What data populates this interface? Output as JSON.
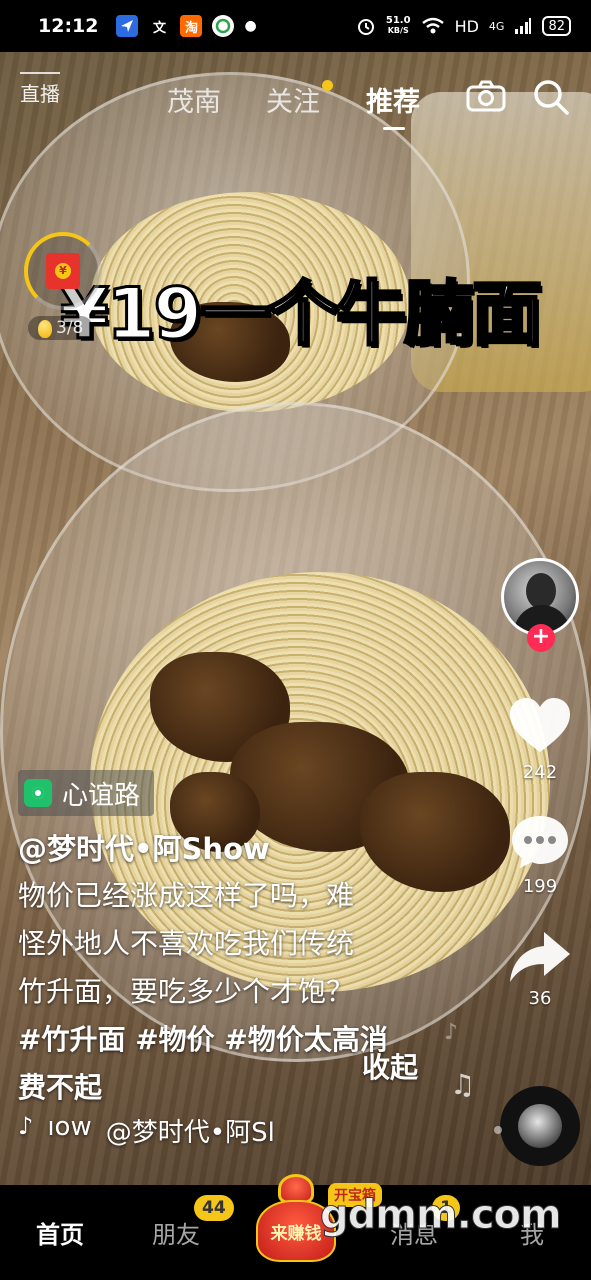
{
  "status_bar": {
    "time": "12:12",
    "apps": [
      "map-app",
      "文",
      "淘",
      "weibo-app"
    ],
    "net_speed_value": "51.0",
    "net_speed_unit": "KB/S",
    "network": "HD",
    "signal": "4G",
    "battery": "82"
  },
  "top_nav": {
    "live_label": "直播",
    "tabs": [
      {
        "label": "茂南",
        "active": false
      },
      {
        "label": "关注",
        "active": false,
        "has_dot": true
      },
      {
        "label": "推荐",
        "active": true
      }
    ],
    "icons": [
      "camera-icon",
      "search-icon"
    ]
  },
  "video": {
    "overlay_title": "¥19一个牛腩面",
    "red_packet_progress": "3/8"
  },
  "right_rail": {
    "likes": "242",
    "comments": "199",
    "shares": "36",
    "follow_symbol": "+"
  },
  "post": {
    "location": "心谊路",
    "author": "@梦时代•阿Show",
    "description_lines": [
      "物价已经涨成这样了吗，难",
      "怪外地人不喜欢吃我们传统",
      "竹升面，要吃多少个才饱？"
    ],
    "tags_line1": "#竹升面 #物价 #物价太高消",
    "tags_line2": "费不起",
    "collapse_label": "收起",
    "music_text": "ıow",
    "music_author": "@梦时代•阿Sl"
  },
  "bottom_nav": {
    "items": [
      {
        "label": "首页",
        "active": true
      },
      {
        "label": "朋友",
        "badge": "44"
      },
      {
        "label": "消息",
        "badge": "1"
      },
      {
        "label": "我"
      }
    ],
    "earn_label": "来赚钱",
    "chest_label": "开宝箱"
  },
  "watermark": "gdmm.com",
  "colors": {
    "accent_red": "#fe2c55",
    "badge_yellow": "#f5c518",
    "location_green": "#1fc26b"
  }
}
